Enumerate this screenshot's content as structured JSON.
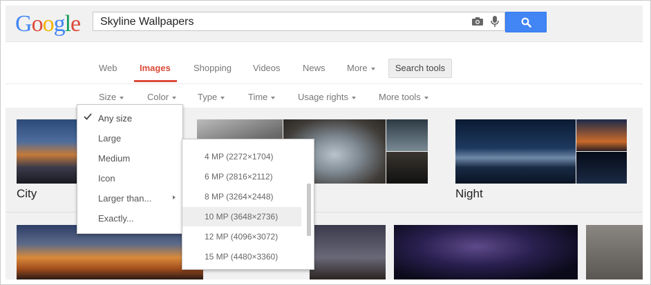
{
  "logo": {
    "letters": [
      "G",
      "o",
      "o",
      "g",
      "l",
      "e"
    ],
    "colors": [
      "#4285f4",
      "#dd4b39",
      "#f4b400",
      "#4285f4",
      "#0f9d58",
      "#dd4b39"
    ]
  },
  "search": {
    "query": "Skyline Wallpapers",
    "camera_icon": "camera-icon",
    "mic_icon": "microphone-icon",
    "button_icon": "search-icon"
  },
  "nav": {
    "tabs": [
      {
        "label": "Web"
      },
      {
        "label": "Images",
        "active": true
      },
      {
        "label": "Shopping"
      },
      {
        "label": "Videos"
      },
      {
        "label": "News"
      },
      {
        "label": "More"
      }
    ],
    "search_tools": "Search tools"
  },
  "tools": [
    "Size",
    "Color",
    "Type",
    "Time",
    "Usage rights",
    "More tools"
  ],
  "results": {
    "captions": [
      "City",
      "Night"
    ]
  },
  "size_menu": {
    "items": [
      "Any size",
      "Large",
      "Medium",
      "Icon",
      "Larger than...",
      "Exactly..."
    ],
    "selected": "Any size"
  },
  "larger_than_menu": {
    "items": [
      "4 MP (2272×1704)",
      "6 MP (2816×2112)",
      "8 MP (3264×2448)",
      "10 MP (3648×2736)",
      "12 MP (4096×3072)",
      "15 MP (4480×3360)"
    ],
    "highlighted": "10 MP (3648×2736)"
  },
  "colors": {
    "accent_red": "#dd4b39",
    "search_blue": "#4285f4"
  }
}
